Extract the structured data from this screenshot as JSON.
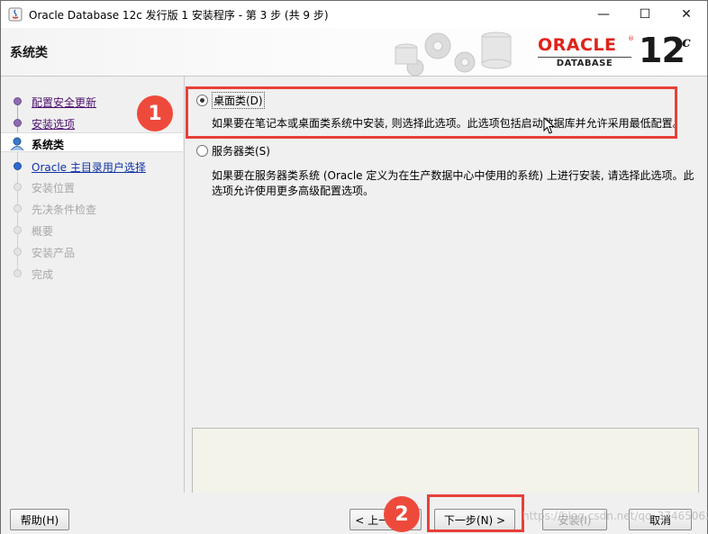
{
  "window": {
    "title": "Oracle Database 12c 发行版 1 安装程序 - 第 3 步 (共 9 步)",
    "controls": {
      "minimize": "—",
      "maximize": "☐",
      "close": "✕"
    }
  },
  "header": {
    "page_title": "系统类",
    "logo_word": "ORACLE",
    "logo_reg": "®",
    "logo_sub": "DATABASE",
    "version": "12",
    "version_suffix": "c"
  },
  "steps": [
    {
      "label": "配置安全更新",
      "state": "done"
    },
    {
      "label": "安装选项",
      "state": "done"
    },
    {
      "label": "系统类",
      "state": "current"
    },
    {
      "label": "Oracle 主目录用户选择",
      "state": "link"
    },
    {
      "label": "安装位置",
      "state": "pending"
    },
    {
      "label": "先决条件检查",
      "state": "pending"
    },
    {
      "label": "概要",
      "state": "pending"
    },
    {
      "label": "安装产品",
      "state": "pending"
    },
    {
      "label": "完成",
      "state": "pending"
    }
  ],
  "options": [
    {
      "label": "桌面类(D)",
      "selected": true,
      "description": [
        "如果要在笔记本或桌面类系统中安装, 则选择此选项。此选项包括启动数据库并允许采用最低配置。"
      ]
    },
    {
      "label": "服务器类(S)",
      "selected": false,
      "description": [
        "如果要在服务器类系统 (Oracle 定义为在生产数据中心中使用的系统) 上进行安装, 请选择此选项。此",
        "选项允许使用更多高级配置选项。"
      ]
    }
  ],
  "footer": {
    "help": "帮助(H)",
    "back": "< 上一步(B)",
    "next": "下一步(N) >",
    "install": "安装(I)",
    "cancel": "取消"
  },
  "annotations": {
    "badge1": "1",
    "badge2": "2"
  },
  "watermark": "https://blog.csdn.net/qq_37465062",
  "colors": {
    "accent": "#e8403a",
    "oracle_red": "#e0231a",
    "done_step": "#4b0f6e",
    "link_step": "#1033a6"
  }
}
